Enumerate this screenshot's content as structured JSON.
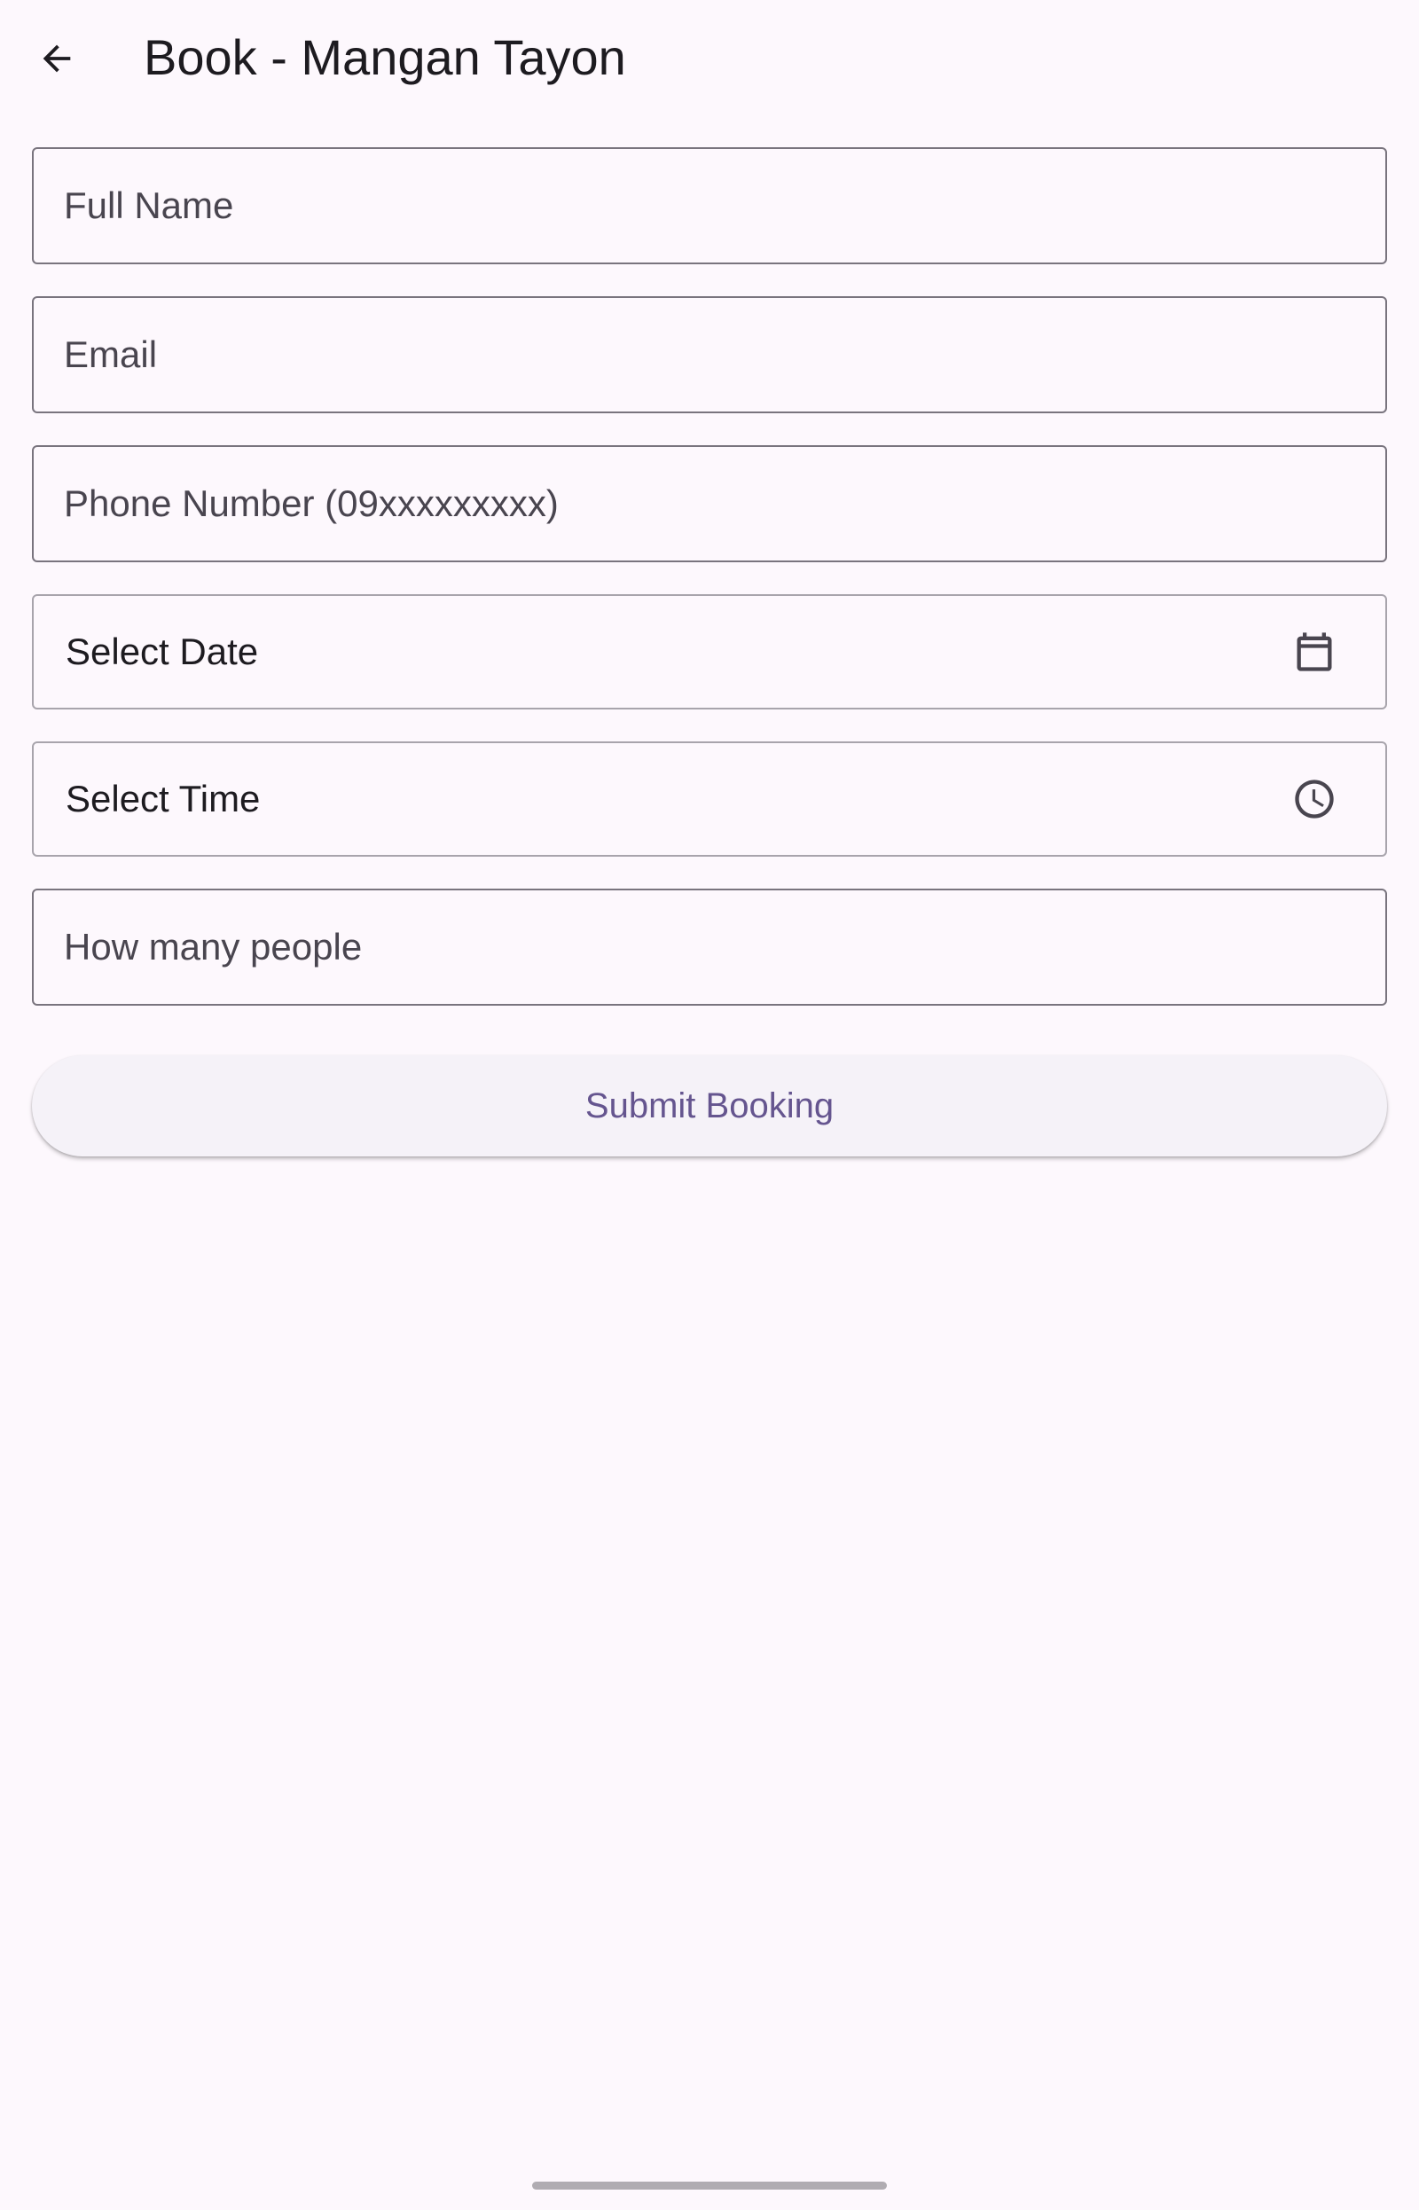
{
  "app_bar": {
    "back_icon": "arrow-back-icon",
    "title": "Book - Mangan Tayon"
  },
  "form": {
    "full_name": {
      "placeholder": "Full Name",
      "value": ""
    },
    "email": {
      "placeholder": "Email",
      "value": ""
    },
    "phone": {
      "placeholder": "Phone Number (09xxxxxxxxx)",
      "value": ""
    },
    "date": {
      "label": "Select Date",
      "icon": "calendar-icon"
    },
    "time": {
      "label": "Select Time",
      "icon": "clock-icon"
    },
    "people": {
      "placeholder": "How many people",
      "value": ""
    }
  },
  "submit": {
    "label": "Submit Booking"
  },
  "colors": {
    "background": "#FDF8FD",
    "accent": "#65558F",
    "outline": "#79747E",
    "button_bg": "#F5F2F8"
  }
}
